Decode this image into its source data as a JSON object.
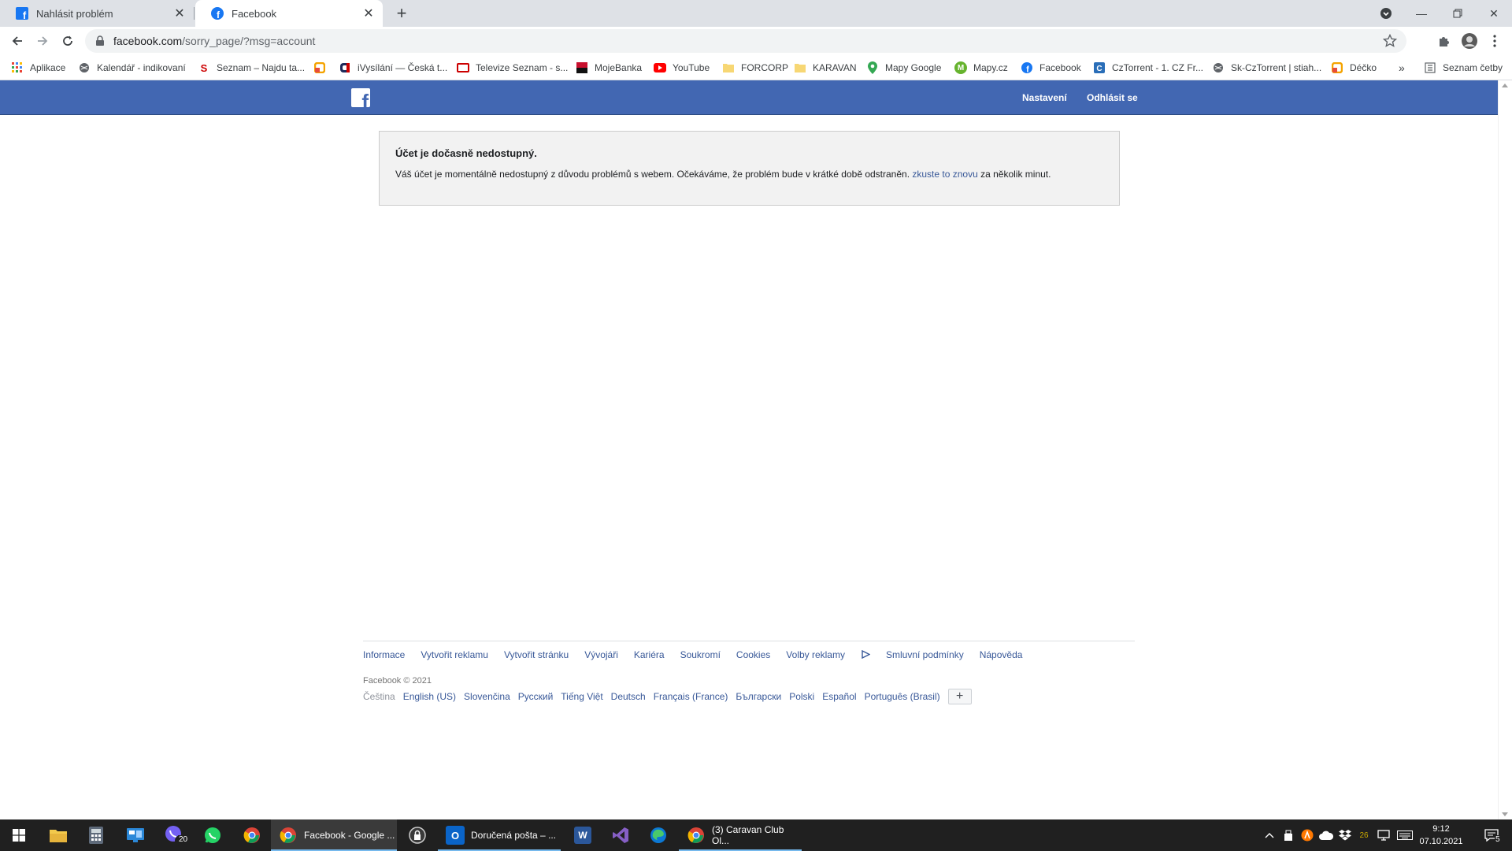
{
  "browser": {
    "tabs": [
      {
        "title": "Nahlásit problém"
      },
      {
        "title": "Facebook"
      }
    ],
    "url_host": "facebook.com",
    "url_path": "/sorry_page/?msg=account",
    "bookmarks": [
      {
        "label": "Aplikace",
        "icon": "apps-grid-icon",
        "color": "#ea4335"
      },
      {
        "label": "Kalendář - indikovaní",
        "icon": "globe-icon",
        "color": "#5f6368"
      },
      {
        "label": "Seznam – Najdu ta...",
        "icon": "seznam-icon",
        "color": "#cc0000"
      },
      {
        "label": "",
        "icon": "decko-icon",
        "color": "#f4a300"
      },
      {
        "label": "iVysílání — Česká t...",
        "icon": "ct-icon",
        "color": "#cc0000"
      },
      {
        "label": "Televize Seznam - s...",
        "icon": "tv-seznam-icon",
        "color": "#cc0000"
      },
      {
        "label": "MojeBanka",
        "icon": "bank-icon",
        "color": "#c8102e"
      },
      {
        "label": "YouTube",
        "icon": "youtube-icon",
        "color": "#ff0000"
      },
      {
        "label": "FORCORP",
        "icon": "folder-icon",
        "color": "#f7d774"
      },
      {
        "label": "KARAVAN",
        "icon": "folder-icon",
        "color": "#f7d774"
      },
      {
        "label": "Mapy Google",
        "icon": "map-pin-icon",
        "color": "#34a853"
      },
      {
        "label": "Mapy.cz",
        "icon": "mapy-icon",
        "color": "#66b32e"
      },
      {
        "label": "Facebook",
        "icon": "facebook-icon",
        "color": "#1877f2"
      },
      {
        "label": "CzTorrent - 1. CZ Fr...",
        "icon": "torrent-icon",
        "color": "#2a6eb8"
      },
      {
        "label": "Sk-CzTorrent | stiah...",
        "icon": "globe-icon",
        "color": "#5f6368"
      },
      {
        "label": "Déčko",
        "icon": "decko-icon",
        "color": "#f4a300"
      }
    ],
    "bookmarks_overflow": "»",
    "reading_list": "Seznam četby"
  },
  "facebook": {
    "nav_settings": "Nastavení",
    "nav_logout": "Odhlásit se",
    "error_title": "Účet je dočasně nedostupný.",
    "error_text_before": "Váš účet je momentálně nedostupný z důvodu problémů s webem. Očekáváme, že problém bude v krátké době odstraněn. ",
    "error_link": "zkuste to znovu",
    "error_text_after": " za několik minut.",
    "footer_links": [
      "Informace",
      "Vytvořit reklamu",
      "Vytvořit stránku",
      "Vývojáři",
      "Kariéra",
      "Soukromí",
      "Cookies",
      "Volby reklamy",
      "Smluvní podmínky",
      "Nápověda"
    ],
    "copyright": "Facebook © 2021",
    "current_language": "Čeština",
    "languages": [
      "English (US)",
      "Slovenčina",
      "Русский",
      "Tiếng Việt",
      "Deutsch",
      "Français (France)",
      "Български",
      "Polski",
      "Español",
      "Português (Brasil)"
    ],
    "more_languages": "+"
  },
  "taskbar": {
    "apps": [
      {
        "label": "Facebook - Google ...",
        "active": true
      },
      {
        "label": "Doručená pošta – ...",
        "active": false
      },
      {
        "label": "(3) Caravan Club Ol...",
        "active": false
      }
    ],
    "viber_badge": "20",
    "tray_temp": "26",
    "time": "9:12",
    "date": "07.10.2021",
    "notifications": "5"
  }
}
